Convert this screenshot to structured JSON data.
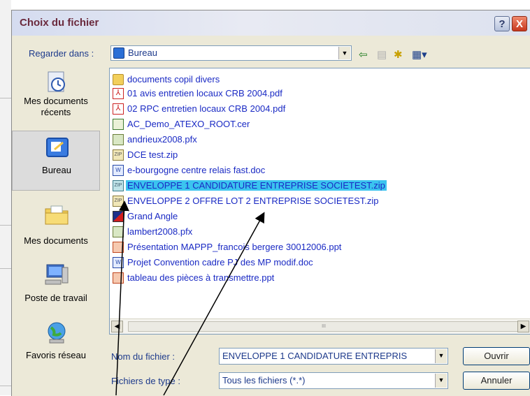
{
  "dialog": {
    "title": "Choix du fichier",
    "help_glyph": "?",
    "close_glyph": "X",
    "look_in_label": "Regarder dans :",
    "look_in_value": "Bureau",
    "filename_label": "Nom du fichier :",
    "filename_value": "ENVELOPPE 1 CANDIDATURE ENTREPRIS",
    "filetype_label": "Fichiers de type :",
    "filetype_value": "Tous les fichiers (*.*)",
    "open_button": "Ouvrir",
    "cancel_button": "Annuler",
    "toolbar_icons": [
      "back-arrow-icon",
      "up-folder-icon",
      "new-folder-icon",
      "view-menu-icon"
    ]
  },
  "places": [
    {
      "label": "Mes documents récents",
      "icon": "recent-documents-icon"
    },
    {
      "label": "Bureau",
      "icon": "desktop-icon",
      "selected": true
    },
    {
      "label": "Mes documents",
      "icon": "my-documents-icon"
    },
    {
      "label": "Poste de travail",
      "icon": "computer-icon"
    },
    {
      "label": "Favoris réseau",
      "icon": "network-icon"
    }
  ],
  "files": [
    {
      "name": "documents copil divers",
      "icon": "folder-icon"
    },
    {
      "name": "01 avis entretien locaux CRB 2004.pdf",
      "icon": "pdf-icon"
    },
    {
      "name": "02 RPC entretien locaux CRB 2004.pdf",
      "icon": "pdf-icon"
    },
    {
      "name": "AC_Demo_ATEXO_ROOT.cer",
      "icon": "certificate-icon"
    },
    {
      "name": "andrieux2008.pfx",
      "icon": "pfx-icon"
    },
    {
      "name": "DCE test.zip",
      "icon": "zip-icon"
    },
    {
      "name": "e-bourgogne centre relais fast.doc",
      "icon": "doc-icon"
    },
    {
      "name": "ENVELOPPE 1 CANDIDATURE ENTREPRISE SOCIETEST.zip",
      "icon": "zip-icon",
      "selected": true
    },
    {
      "name": "ENVELOPPE 2 OFFRE LOT 2 ENTREPRISE SOCIETEST.zip",
      "icon": "zip-icon"
    },
    {
      "name": "Grand Angle",
      "icon": "shortcut-icon"
    },
    {
      "name": "lambert2008.pfx",
      "icon": "pfx-icon"
    },
    {
      "name": "Présentation MAPPP_francois bergere 30012006.ppt",
      "icon": "ppt-icon"
    },
    {
      "name": "Projet Convention cadre PJ des MP modif.doc",
      "icon": "doc-icon"
    },
    {
      "name": "tableau des pièces à transmettre.ppt",
      "icon": "ppt-icon"
    }
  ],
  "scrollbar_grip": "III",
  "colors": {
    "selection": "#3bc4ef",
    "file_text": "#1a2ac4",
    "label_text": "#1d3a8b",
    "dialog_bg": "#ece9d8"
  }
}
